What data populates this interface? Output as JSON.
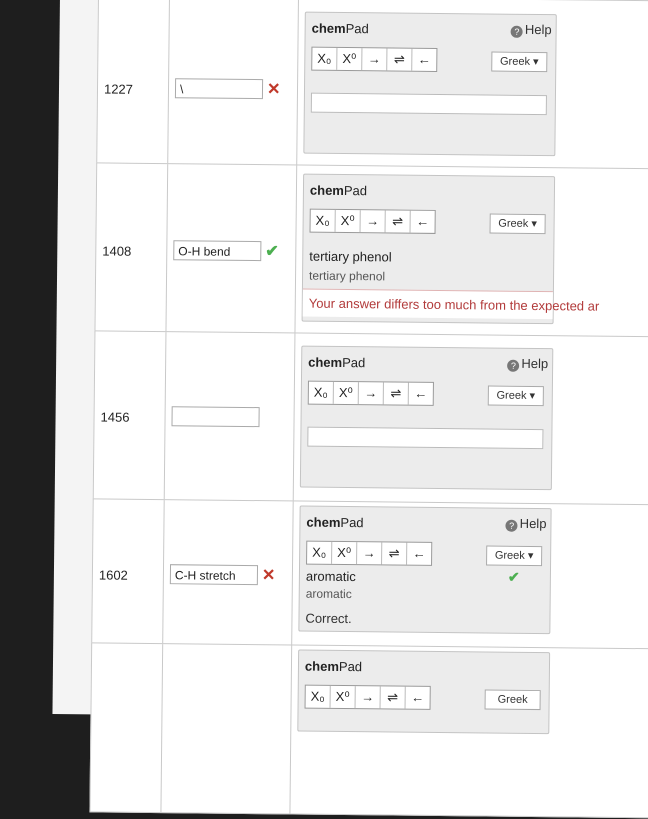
{
  "colors": {
    "error": "#c0392b",
    "success": "#4caf50"
  },
  "rows": [
    {
      "number": "1227",
      "answer": "\\",
      "status_icon": "cross-icon",
      "pad": {
        "title_bold": "chem",
        "title_normal": "Pad",
        "help": "Help",
        "greek": "Greek ▾",
        "tools": [
          "X₀",
          "X⁰",
          "→",
          "⇌",
          "←"
        ]
      }
    },
    {
      "number": "1408",
      "answer": "O-H bend",
      "status_icon": "check-icon",
      "pad": {
        "title_bold": "chem",
        "title_normal": "Pad",
        "greek": "Greek ▾",
        "tools": [
          "X₀",
          "X⁰",
          "→",
          "⇌",
          "←"
        ],
        "typed": "tertiary phenol",
        "preview": "tertiary phenol",
        "feedback": "Your answer differs too much from the expected ar"
      }
    },
    {
      "number": "1456",
      "answer": "",
      "pad": {
        "title_bold": "chem",
        "title_normal": "Pad",
        "help": "Help",
        "greek": "Greek ▾",
        "tools": [
          "X₀",
          "X⁰",
          "→",
          "⇌",
          "←"
        ]
      }
    },
    {
      "number": "1602",
      "answer": "C-H stretch",
      "status_icon": "cross-icon",
      "pad": {
        "title_bold": "chem",
        "title_normal": "Pad",
        "help": "Help",
        "greek": "Greek ▾",
        "tools": [
          "X₀",
          "X⁰",
          "→",
          "⇌",
          "←"
        ],
        "typed": "aromatic",
        "preview": "aromatic",
        "feedback": "Correct."
      }
    },
    {
      "number": "",
      "answer": "",
      "pad": {
        "title_bold": "chem",
        "title_normal": "Pad",
        "greek": "Greek",
        "tools": [
          "X₀",
          "X⁰",
          "→",
          "⇌",
          "←"
        ]
      }
    }
  ]
}
